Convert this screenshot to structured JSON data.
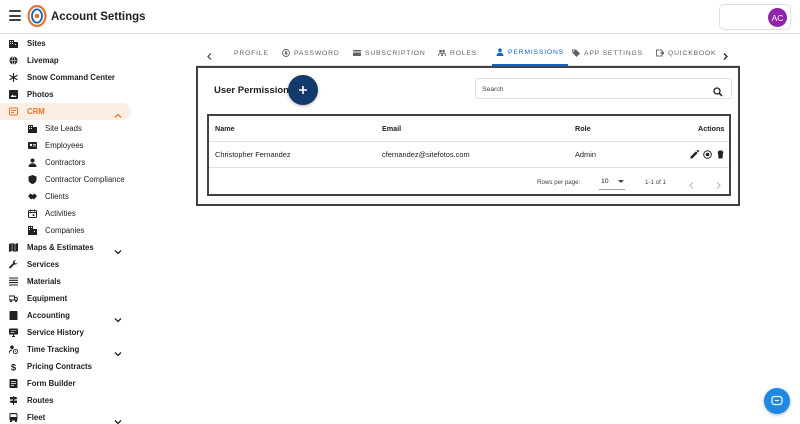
{
  "header": {
    "title": "Account Settings",
    "avatar_initials": "AC",
    "avatar_color": "#8e24aa"
  },
  "sidebar": {
    "accent_color": "#e8732a",
    "items": [
      {
        "label": "Sites",
        "icon": "business-icon"
      },
      {
        "label": "Livemap",
        "icon": "globe-icon"
      },
      {
        "label": "Snow Command Center",
        "icon": "snowflake-icon"
      },
      {
        "label": "Photos",
        "icon": "image-icon"
      },
      {
        "label": "CRM",
        "icon": "crm-icon",
        "active": true,
        "expanded": true
      },
      {
        "label": "Site Leads",
        "icon": "business-icon",
        "sub": true
      },
      {
        "label": "Employees",
        "icon": "badge-icon",
        "sub": true
      },
      {
        "label": "Contractors",
        "icon": "person-icon",
        "sub": true
      },
      {
        "label": "Contractor Compliance",
        "icon": "shield-icon",
        "sub": true
      },
      {
        "label": "Clients",
        "icon": "handshake-icon",
        "sub": true
      },
      {
        "label": "Activities",
        "icon": "calendar-icon",
        "sub": true
      },
      {
        "label": "Companies",
        "icon": "domain-icon",
        "sub": true
      },
      {
        "label": "Maps & Estimates",
        "icon": "map-icon",
        "chevron": true
      },
      {
        "label": "Services",
        "icon": "wrench-icon"
      },
      {
        "label": "Materials",
        "icon": "layers-icon"
      },
      {
        "label": "Equipment",
        "icon": "truck-icon"
      },
      {
        "label": "Accounting",
        "icon": "book-icon",
        "chevron": true
      },
      {
        "label": "Service History",
        "icon": "monitor-icon"
      },
      {
        "label": "Time Tracking",
        "icon": "clock-person-icon",
        "chevron": true
      },
      {
        "label": "Pricing Contracts",
        "icon": "dollar-icon"
      },
      {
        "label": "Form Builder",
        "icon": "form-icon"
      },
      {
        "label": "Routes",
        "icon": "signpost-icon"
      },
      {
        "label": "Fleet",
        "icon": "bus-icon",
        "chevron": true
      }
    ]
  },
  "tabs": {
    "accent_color": "#1565c0",
    "items": [
      {
        "label": "PROFILE",
        "icon": ""
      },
      {
        "label": "PASSWORD",
        "icon": "lock-icon"
      },
      {
        "label": "SUBSCRIPTION",
        "icon": "card-icon"
      },
      {
        "label": "ROLES",
        "icon": "roles-icon"
      },
      {
        "label": "PERMISSIONS",
        "icon": "person-icon",
        "active": true
      },
      {
        "label": "APP SETTINGS",
        "icon": "tag-icon"
      },
      {
        "label": "QUICKBOOK",
        "icon": "export-icon"
      }
    ]
  },
  "permissions": {
    "title": "User Permissions",
    "search_placeholder": "Search",
    "columns": [
      "Name",
      "Email",
      "Role",
      "Actions"
    ],
    "rows": [
      {
        "name": "Christopher Fernandez",
        "email": "cfernandez@sitefotos.com",
        "role": "Admin"
      }
    ],
    "pagination": {
      "rows_per_page_label": "Rows per page:",
      "rows_per_page_value": "10",
      "range": "1-1 of 1"
    }
  }
}
